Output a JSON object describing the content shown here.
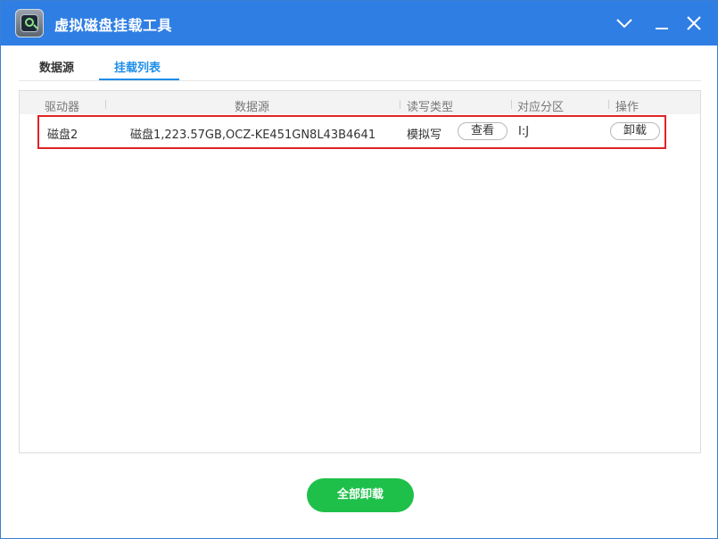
{
  "window": {
    "title": "虚拟磁盘挂载工具"
  },
  "tabs": [
    {
      "label": "数据源",
      "active": false
    },
    {
      "label": "挂载列表",
      "active": true
    }
  ],
  "table": {
    "columns": [
      "驱动器",
      "数据源",
      "读写类型",
      "对应分区",
      "操作"
    ],
    "rows": [
      {
        "drive": "磁盘2",
        "source": "磁盘1,223.57GB,OCZ-KE451GN8L43B4641",
        "rw_type": "模拟写",
        "view_label": "查看",
        "partition": "I:J",
        "action_label": "卸载",
        "highlighted": true
      }
    ]
  },
  "footer": {
    "unmount_all_label": "全部卸载"
  },
  "colors": {
    "titlebar": "#2f7ee3",
    "accent": "#1e8ee9",
    "highlight": "#e02424",
    "primary_button": "#1fc04a"
  },
  "icons": {
    "app": "disk-magnifier-icon",
    "collapse": "chevron-down-icon",
    "minimize": "minimize-icon",
    "close": "close-icon"
  }
}
